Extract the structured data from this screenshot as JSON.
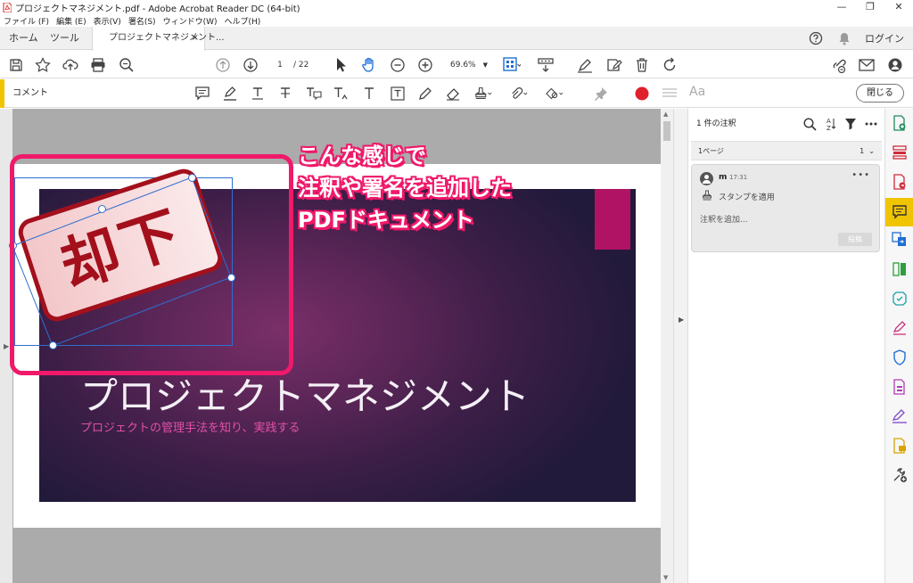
{
  "window": {
    "title": "プロジェクトマネジメント.pdf - Adobe Acrobat Reader DC (64-bit)",
    "controls": [
      "—",
      "❐",
      "✕"
    ]
  },
  "menu": [
    "ファイル (F)",
    "編集 (E)",
    "表示(V)",
    "署名(S)",
    "ウィンドウ(W)",
    "ヘルプ(H)"
  ],
  "tabs": {
    "home": "ホーム",
    "tools": "ツール",
    "document": "プロジェクトマネジメント...",
    "close": "×",
    "login": "ログイン"
  },
  "toolbar": {
    "page_current": "1",
    "page_total": "/  22",
    "zoom": "69.6%"
  },
  "comment_bar": {
    "label": "コメント",
    "close_button": "閉じる",
    "font_label": "Aa"
  },
  "document": {
    "slide_title": "プロジェクトマネジメント",
    "slide_subtitle": "プロジェクトの管理手法を知り、実践する",
    "stamp_text": "却下",
    "callout_lines": [
      "こんな感じで",
      "注釈や署名を追加した",
      "PDFドキュメント"
    ]
  },
  "comments_pane": {
    "header": "1 件の注釈",
    "page_group": "1ページ",
    "page_count": "1",
    "comment": {
      "user": "m",
      "time": "17:31",
      "action": "スタンプを適用",
      "reply_placeholder": "注釈を追加...",
      "post_button": "投稿"
    }
  },
  "colors": {
    "accent_yellow": "#f0c400",
    "callout_pink": "#f0196a",
    "stamp_red": "#a3101c",
    "slide_magenta": "#b01264"
  }
}
